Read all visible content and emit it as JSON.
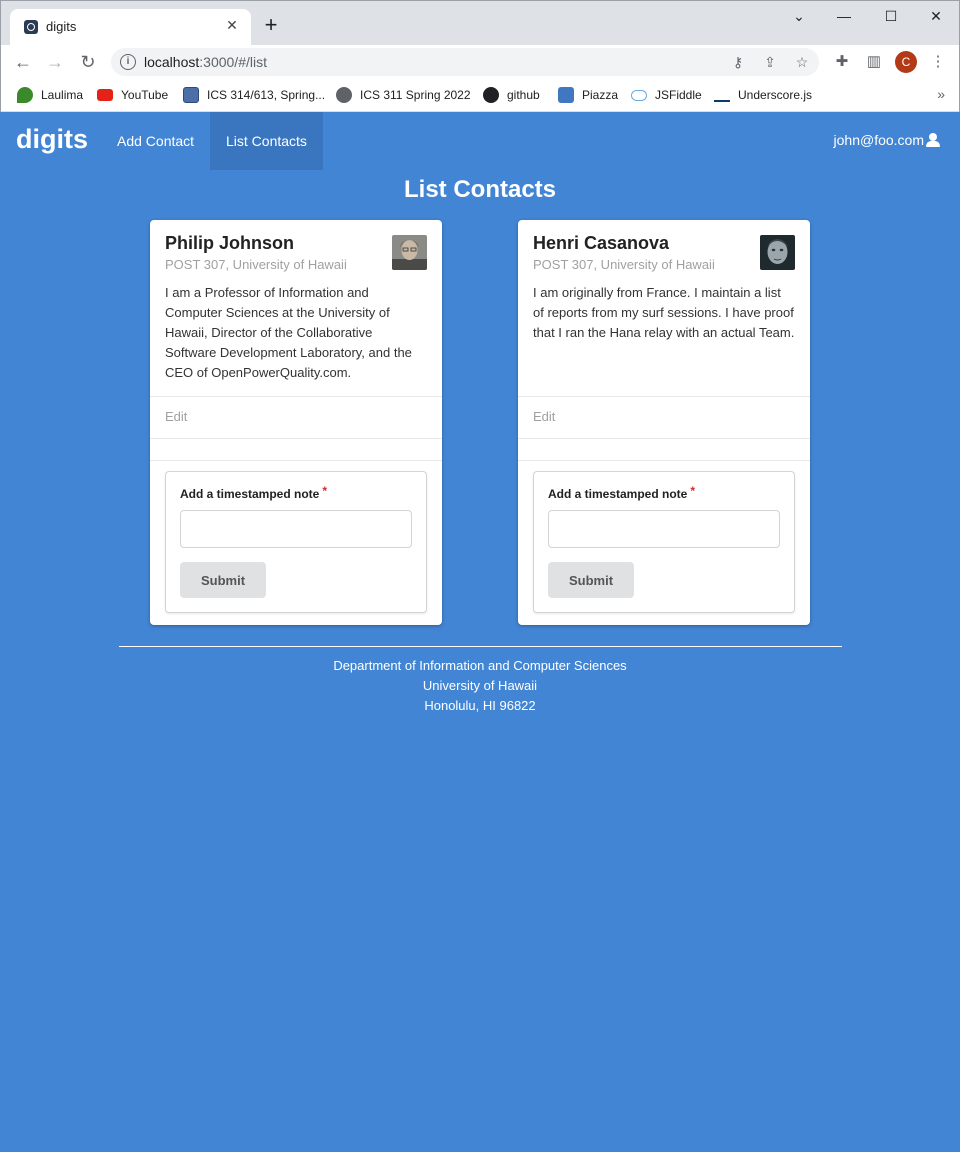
{
  "browser": {
    "tab_title": "digits",
    "url_host": "localhost",
    "url_path": ":3000/#/list",
    "new_tab": "+",
    "bookmarks": [
      {
        "label": "Laulima",
        "icon": "leaf-icon",
        "color": "#3a8a2a"
      },
      {
        "label": "YouTube",
        "icon": "youtube-icon",
        "color": "#e62117"
      },
      {
        "label": "ICS 314/613, Spring...",
        "icon": "square-icon",
        "color": "#4b6fa6"
      },
      {
        "label": "ICS 311 Spring 2022",
        "icon": "globe-icon",
        "color": "#5f6368"
      },
      {
        "label": "github",
        "icon": "github-icon",
        "color": "#202124"
      },
      {
        "label": "Piazza",
        "icon": "piazza-icon",
        "color": "#3f78c0"
      },
      {
        "label": "JSFiddle",
        "icon": "cloud-icon",
        "color": "#6aa9e3"
      },
      {
        "label": "Underscore.js",
        "icon": "underscore-icon",
        "color": "#0d3a6b"
      }
    ],
    "profile_initial": "C"
  },
  "app": {
    "brand": "digits",
    "nav": {
      "add_contact": "Add Contact",
      "list_contacts": "List Contacts",
      "user": "john@foo.com"
    },
    "page_title": "List Contacts",
    "contacts": [
      {
        "name": "Philip Johnson",
        "address": "POST 307, University of Hawaii",
        "description": "I am a Professor of Information and Computer Sciences at the University of Hawaii, Director of the Collaborative Software Development Laboratory, and the CEO of OpenPowerQuality.com.",
        "edit_label": "Edit",
        "note_label": "Add a timestamped note",
        "note_value": "",
        "submit_label": "Submit"
      },
      {
        "name": "Henri Casanova",
        "address": "POST 307, University of Hawaii",
        "description": "I am originally from France. I maintain a list of reports from my surf sessions. I have proof that I ran the Hana relay with an actual Team.",
        "edit_label": "Edit",
        "note_label": "Add a timestamped note",
        "note_value": "",
        "submit_label": "Submit"
      }
    ],
    "required_mark": "*",
    "footer": {
      "line1": "Department of Information and Computer Sciences",
      "line2": "University of Hawaii",
      "line3": "Honolulu, HI 96822"
    }
  },
  "colors": {
    "background": "#4285d4",
    "active_nav": "#3a76bf"
  }
}
